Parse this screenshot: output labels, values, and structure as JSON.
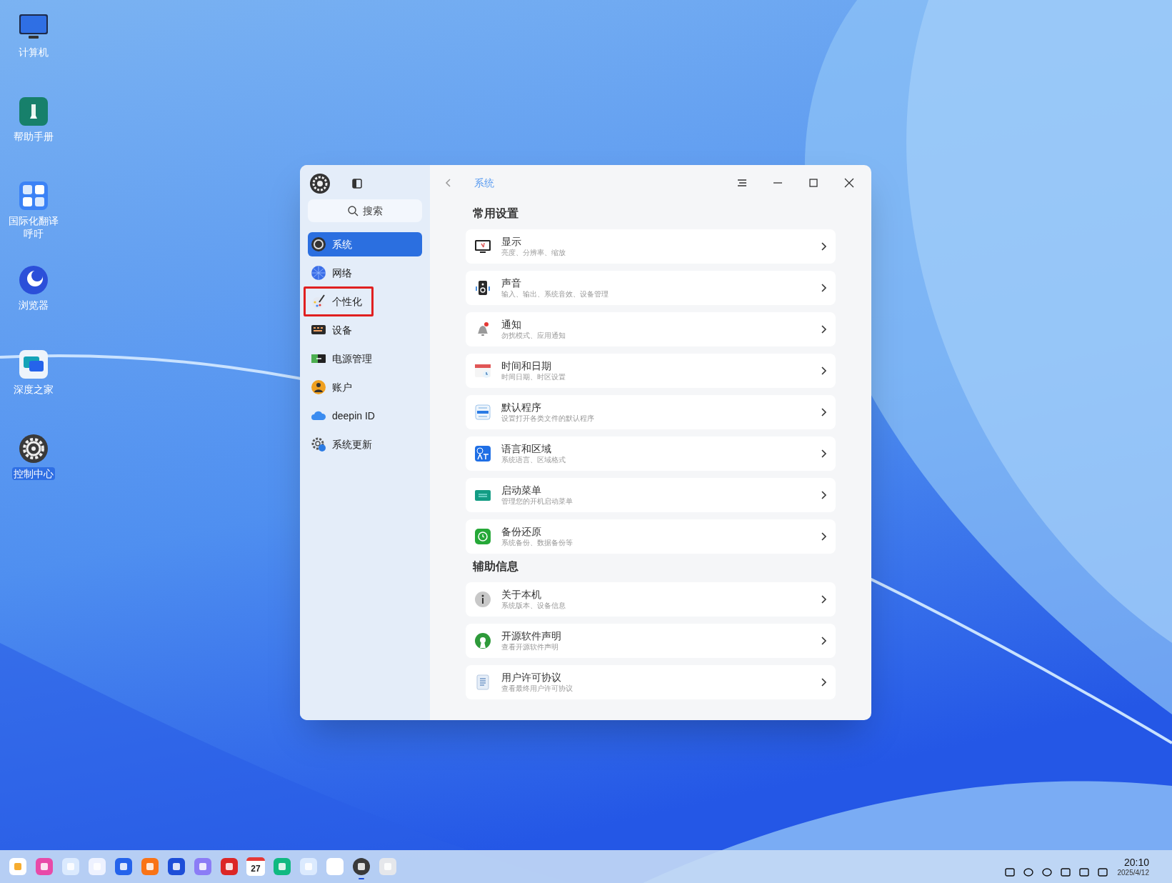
{
  "desktop_icons": [
    {
      "label": "计算机",
      "selected": false
    },
    {
      "label": "帮助手册",
      "selected": false
    },
    {
      "label": "国际化翻译呼吁",
      "selected": false
    },
    {
      "label": "浏览器",
      "selected": false
    },
    {
      "label": "深度之家",
      "selected": false
    },
    {
      "label": "控制中心",
      "selected": true
    }
  ],
  "window": {
    "sidebar": {
      "search": {
        "placeholder": "搜索"
      },
      "items": [
        {
          "label": "系统",
          "selected": true,
          "highlighted": false
        },
        {
          "label": "网络",
          "selected": false,
          "highlighted": false
        },
        {
          "label": "个性化",
          "selected": false,
          "highlighted": true
        },
        {
          "label": "设备",
          "selected": false,
          "highlighted": false
        },
        {
          "label": "电源管理",
          "selected": false,
          "highlighted": false
        },
        {
          "label": "账户",
          "selected": false,
          "highlighted": false
        },
        {
          "label": "deepin ID",
          "selected": false,
          "highlighted": false
        },
        {
          "label": "系统更新",
          "selected": false,
          "highlighted": false
        }
      ]
    },
    "breadcrumb": "系统",
    "sections": [
      {
        "title": "常用设置",
        "items": [
          {
            "title": "显示",
            "subtitle": "亮度、分辨率、缩放"
          },
          {
            "title": "声音",
            "subtitle": "输入、输出、系统音效、设备管理"
          },
          {
            "title": "通知",
            "subtitle": "勿扰模式、应用通知"
          },
          {
            "title": "时间和日期",
            "subtitle": "时间日期、时区设置"
          },
          {
            "title": "默认程序",
            "subtitle": "设置打开各类文件的默认程序"
          },
          {
            "title": "语言和区域",
            "subtitle": "系统语言、区域格式"
          },
          {
            "title": "启动菜单",
            "subtitle": "管理您的开机启动菜单"
          },
          {
            "title": "备份还原",
            "subtitle": "系统备份、数据备份等"
          }
        ]
      },
      {
        "title": "辅助信息",
        "items": [
          {
            "title": "关于本机",
            "subtitle": "系统版本、设备信息"
          },
          {
            "title": "开源软件声明",
            "subtitle": "查看开源软件声明"
          },
          {
            "title": "用户许可协议",
            "subtitle": "查看最终用户许可协议"
          }
        ]
      }
    ]
  },
  "taskbar": {
    "apps": [
      {
        "running": false
      },
      {
        "running": false
      },
      {
        "running": false
      },
      {
        "running": false
      },
      {
        "running": false
      },
      {
        "running": false
      },
      {
        "running": false
      },
      {
        "running": false
      },
      {
        "running": false
      },
      {
        "running": false
      },
      {
        "running": false
      },
      {
        "running": false
      },
      {
        "running": false
      },
      {
        "running": true
      },
      {
        "running": false
      }
    ],
    "calendar_day": "27",
    "time": "20:10",
    "date": "2025/4/12"
  }
}
